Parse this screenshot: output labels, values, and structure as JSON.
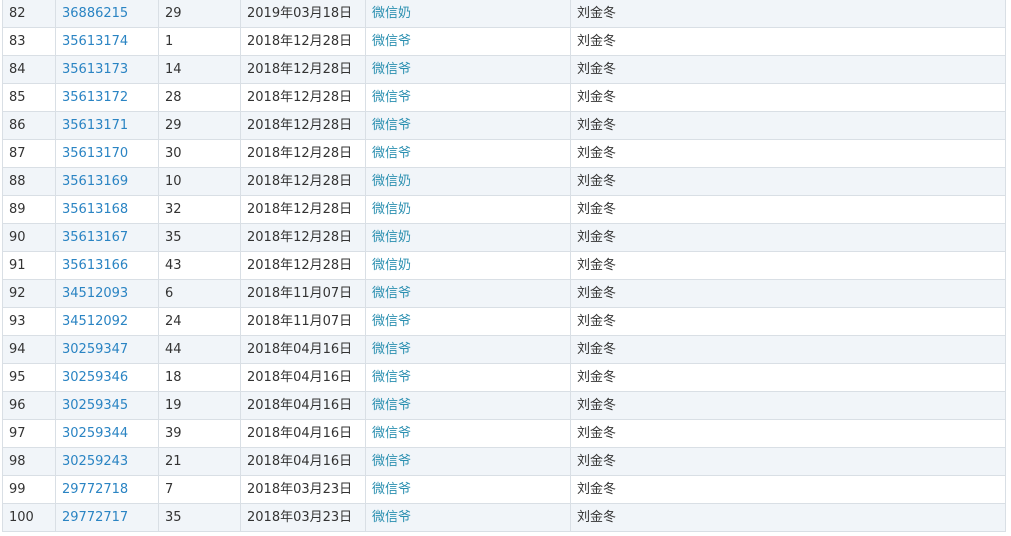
{
  "rows": [
    {
      "index": "82",
      "id": "36886215",
      "count": "29",
      "date": "2019年03月18日",
      "category": "微信奶",
      "author": "刘金冬"
    },
    {
      "index": "83",
      "id": "35613174",
      "count": "1",
      "date": "2018年12月28日",
      "category": "微信爷",
      "author": "刘金冬"
    },
    {
      "index": "84",
      "id": "35613173",
      "count": "14",
      "date": "2018年12月28日",
      "category": "微信爷",
      "author": "刘金冬"
    },
    {
      "index": "85",
      "id": "35613172",
      "count": "28",
      "date": "2018年12月28日",
      "category": "微信爷",
      "author": "刘金冬"
    },
    {
      "index": "86",
      "id": "35613171",
      "count": "29",
      "date": "2018年12月28日",
      "category": "微信爷",
      "author": "刘金冬"
    },
    {
      "index": "87",
      "id": "35613170",
      "count": "30",
      "date": "2018年12月28日",
      "category": "微信爷",
      "author": "刘金冬"
    },
    {
      "index": "88",
      "id": "35613169",
      "count": "10",
      "date": "2018年12月28日",
      "category": "微信奶",
      "author": "刘金冬"
    },
    {
      "index": "89",
      "id": "35613168",
      "count": "32",
      "date": "2018年12月28日",
      "category": "微信奶",
      "author": "刘金冬"
    },
    {
      "index": "90",
      "id": "35613167",
      "count": "35",
      "date": "2018年12月28日",
      "category": "微信奶",
      "author": "刘金冬"
    },
    {
      "index": "91",
      "id": "35613166",
      "count": "43",
      "date": "2018年12月28日",
      "category": "微信奶",
      "author": "刘金冬"
    },
    {
      "index": "92",
      "id": "34512093",
      "count": "6",
      "date": "2018年11月07日",
      "category": "微信爷",
      "author": "刘金冬"
    },
    {
      "index": "93",
      "id": "34512092",
      "count": "24",
      "date": "2018年11月07日",
      "category": "微信爷",
      "author": "刘金冬"
    },
    {
      "index": "94",
      "id": "30259347",
      "count": "44",
      "date": "2018年04月16日",
      "category": "微信爷",
      "author": "刘金冬"
    },
    {
      "index": "95",
      "id": "30259346",
      "count": "18",
      "date": "2018年04月16日",
      "category": "微信爷",
      "author": "刘金冬"
    },
    {
      "index": "96",
      "id": "30259345",
      "count": "19",
      "date": "2018年04月16日",
      "category": "微信爷",
      "author": "刘金冬"
    },
    {
      "index": "97",
      "id": "30259344",
      "count": "39",
      "date": "2018年04月16日",
      "category": "微信爷",
      "author": "刘金冬"
    },
    {
      "index": "98",
      "id": "30259243",
      "count": "21",
      "date": "2018年04月16日",
      "category": "微信爷",
      "author": "刘金冬"
    },
    {
      "index": "99",
      "id": "29772718",
      "count": "7",
      "date": "2018年03月23日",
      "category": "微信爷",
      "author": "刘金冬"
    },
    {
      "index": "100",
      "id": "29772717",
      "count": "35",
      "date": "2018年03月23日",
      "category": "微信爷",
      "author": "刘金冬"
    }
  ]
}
